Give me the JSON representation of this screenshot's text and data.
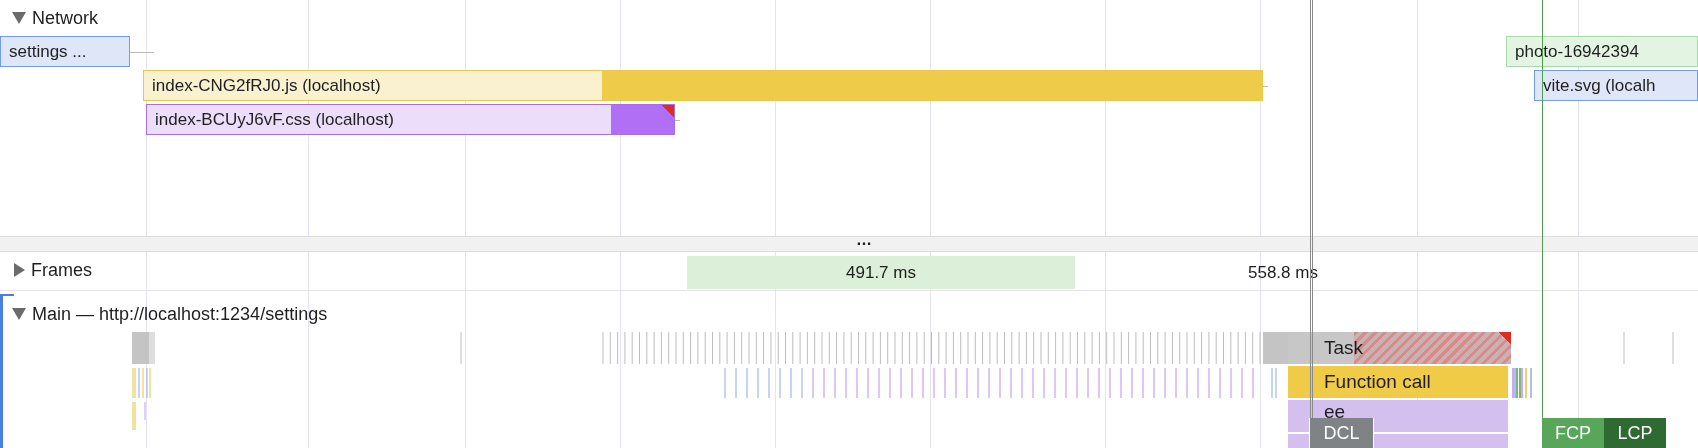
{
  "network": {
    "title": "Network",
    "expanded": true,
    "requests": [
      {
        "label": "settings ...",
        "kind": "document"
      },
      {
        "label": "index-CNG2fRJ0.js (localhost)",
        "kind": "script"
      },
      {
        "label": "index-BCUyJ6vF.css (localhost)",
        "kind": "stylesheet"
      },
      {
        "label": "photo-16942394",
        "kind": "image"
      },
      {
        "label": "vite.svg (localh",
        "kind": "document"
      }
    ]
  },
  "divider": {
    "label": "…"
  },
  "frames": {
    "title": "Frames",
    "expanded": false,
    "items": [
      {
        "duration": "491.7 ms",
        "kind": "block"
      },
      {
        "duration": "558.8 ms",
        "kind": "plain"
      }
    ]
  },
  "main": {
    "title": "Main — http://localhost:1234/settings",
    "expanded": true,
    "events": [
      {
        "label": "Task",
        "kind": "task"
      },
      {
        "label": "Function call",
        "kind": "function"
      },
      {
        "label": "ee",
        "kind": "script"
      }
    ]
  },
  "markers": [
    {
      "label": "DCL",
      "kind": "dcl"
    },
    {
      "label": "FCP",
      "kind": "fcp"
    },
    {
      "label": "LCP",
      "kind": "lcp"
    }
  ]
}
